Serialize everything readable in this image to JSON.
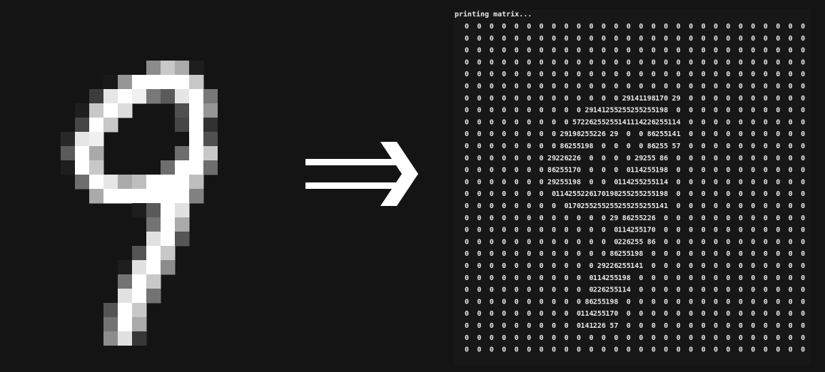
{
  "terminal": {
    "title": "printing matrix..."
  },
  "matrix": [
    [
      0,
      0,
      0,
      0,
      0,
      0,
      0,
      0,
      0,
      0,
      0,
      0,
      0,
      0,
      0,
      0,
      0,
      0,
      0,
      0,
      0,
      0,
      0,
      0,
      0,
      0,
      0,
      0
    ],
    [
      0,
      0,
      0,
      0,
      0,
      0,
      0,
      0,
      0,
      0,
      0,
      0,
      0,
      0,
      0,
      0,
      0,
      0,
      0,
      0,
      0,
      0,
      0,
      0,
      0,
      0,
      0,
      0
    ],
    [
      0,
      0,
      0,
      0,
      0,
      0,
      0,
      0,
      0,
      0,
      0,
      0,
      0,
      0,
      0,
      0,
      0,
      0,
      0,
      0,
      0,
      0,
      0,
      0,
      0,
      0,
      0,
      0
    ],
    [
      0,
      0,
      0,
      0,
      0,
      0,
      0,
      0,
      0,
      0,
      0,
      0,
      0,
      0,
      0,
      0,
      0,
      0,
      0,
      0,
      0,
      0,
      0,
      0,
      0,
      0,
      0,
      0
    ],
    [
      0,
      0,
      0,
      0,
      0,
      0,
      0,
      0,
      0,
      0,
      0,
      0,
      0,
      0,
      0,
      0,
      0,
      0,
      0,
      0,
      0,
      0,
      0,
      0,
      0,
      0,
      0,
      0
    ],
    [
      0,
      0,
      0,
      0,
      0,
      0,
      0,
      0,
      0,
      0,
      0,
      0,
      0,
      0,
      0,
      0,
      0,
      0,
      0,
      0,
      0,
      0,
      0,
      0,
      0,
      0,
      0,
      0
    ],
    [
      0,
      0,
      0,
      0,
      0,
      0,
      0,
      0,
      0,
      0,
      0,
      0,
      0,
      29,
      141,
      198,
      170,
      29,
      0,
      0,
      0,
      0,
      0,
      0,
      0,
      0,
      0,
      0
    ],
    [
      0,
      0,
      0,
      0,
      0,
      0,
      0,
      0,
      0,
      0,
      29,
      141,
      255,
      255,
      255,
      255,
      198,
      0,
      0,
      0,
      0,
      0,
      0,
      0,
      0,
      0,
      0,
      0
    ],
    [
      0,
      0,
      0,
      0,
      0,
      0,
      0,
      0,
      0,
      57,
      226,
      255,
      255,
      141,
      114,
      226,
      255,
      114,
      0,
      0,
      0,
      0,
      0,
      0,
      0,
      0,
      0,
      0
    ],
    [
      0,
      0,
      0,
      0,
      0,
      0,
      0,
      0,
      29,
      198,
      255,
      226,
      29,
      0,
      0,
      86,
      255,
      141,
      0,
      0,
      0,
      0,
      0,
      0,
      0,
      0,
      0,
      0
    ],
    [
      0,
      0,
      0,
      0,
      0,
      0,
      0,
      0,
      86,
      255,
      198,
      0,
      0,
      0,
      0,
      86,
      255,
      57,
      0,
      0,
      0,
      0,
      0,
      0,
      0,
      0,
      0,
      0
    ],
    [
      0,
      0,
      0,
      0,
      0,
      0,
      0,
      29,
      226,
      226,
      0,
      0,
      0,
      0,
      29,
      255,
      86,
      0,
      0,
      0,
      0,
      0,
      0,
      0,
      0,
      0,
      0,
      0
    ],
    [
      0,
      0,
      0,
      0,
      0,
      0,
      0,
      86,
      255,
      170,
      0,
      0,
      0,
      0,
      114,
      255,
      198,
      0,
      0,
      0,
      0,
      0,
      0,
      0,
      0,
      0,
      0,
      0
    ],
    [
      0,
      0,
      0,
      0,
      0,
      0,
      0,
      29,
      255,
      198,
      0,
      0,
      0,
      114,
      255,
      255,
      114,
      0,
      0,
      0,
      0,
      0,
      0,
      0,
      0,
      0,
      0,
      0
    ],
    [
      0,
      0,
      0,
      0,
      0,
      0,
      0,
      0,
      114,
      255,
      226,
      170,
      198,
      255,
      255,
      255,
      198,
      0,
      0,
      0,
      0,
      0,
      0,
      0,
      0,
      0,
      0,
      0
    ],
    [
      0,
      0,
      0,
      0,
      0,
      0,
      0,
      0,
      0,
      170,
      255,
      255,
      255,
      255,
      255,
      255,
      141,
      0,
      0,
      0,
      0,
      0,
      0,
      0,
      0,
      0,
      0,
      0
    ],
    [
      0,
      0,
      0,
      0,
      0,
      0,
      0,
      0,
      0,
      0,
      0,
      0,
      29,
      86,
      255,
      226,
      0,
      0,
      0,
      0,
      0,
      0,
      0,
      0,
      0,
      0,
      0,
      0
    ],
    [
      0,
      0,
      0,
      0,
      0,
      0,
      0,
      0,
      0,
      0,
      0,
      0,
      0,
      114,
      255,
      170,
      0,
      0,
      0,
      0,
      0,
      0,
      0,
      0,
      0,
      0,
      0,
      0
    ],
    [
      0,
      0,
      0,
      0,
      0,
      0,
      0,
      0,
      0,
      0,
      0,
      0,
      0,
      226,
      255,
      86,
      0,
      0,
      0,
      0,
      0,
      0,
      0,
      0,
      0,
      0,
      0,
      0
    ],
    [
      0,
      0,
      0,
      0,
      0,
      0,
      0,
      0,
      0,
      0,
      0,
      0,
      86,
      255,
      198,
      0,
      0,
      0,
      0,
      0,
      0,
      0,
      0,
      0,
      0,
      0,
      0,
      0
    ],
    [
      0,
      0,
      0,
      0,
      0,
      0,
      0,
      0,
      0,
      0,
      0,
      29,
      226,
      255,
      141,
      0,
      0,
      0,
      0,
      0,
      0,
      0,
      0,
      0,
      0,
      0,
      0,
      0
    ],
    [
      0,
      0,
      0,
      0,
      0,
      0,
      0,
      0,
      0,
      0,
      0,
      114,
      255,
      198,
      0,
      0,
      0,
      0,
      0,
      0,
      0,
      0,
      0,
      0,
      0,
      0,
      0,
      0
    ],
    [
      0,
      0,
      0,
      0,
      0,
      0,
      0,
      0,
      0,
      0,
      0,
      226,
      255,
      114,
      0,
      0,
      0,
      0,
      0,
      0,
      0,
      0,
      0,
      0,
      0,
      0,
      0,
      0
    ],
    [
      0,
      0,
      0,
      0,
      0,
      0,
      0,
      0,
      0,
      0,
      86,
      255,
      198,
      0,
      0,
      0,
      0,
      0,
      0,
      0,
      0,
      0,
      0,
      0,
      0,
      0,
      0,
      0
    ],
    [
      0,
      0,
      0,
      0,
      0,
      0,
      0,
      0,
      0,
      0,
      114,
      255,
      170,
      0,
      0,
      0,
      0,
      0,
      0,
      0,
      0,
      0,
      0,
      0,
      0,
      0,
      0,
      0
    ],
    [
      0,
      0,
      0,
      0,
      0,
      0,
      0,
      0,
      0,
      0,
      141,
      226,
      57,
      0,
      0,
      0,
      0,
      0,
      0,
      0,
      0,
      0,
      0,
      0,
      0,
      0,
      0,
      0
    ],
    [
      0,
      0,
      0,
      0,
      0,
      0,
      0,
      0,
      0,
      0,
      0,
      0,
      0,
      0,
      0,
      0,
      0,
      0,
      0,
      0,
      0,
      0,
      0,
      0,
      0,
      0,
      0,
      0
    ],
    [
      0,
      0,
      0,
      0,
      0,
      0,
      0,
      0,
      0,
      0,
      0,
      0,
      0,
      0,
      0,
      0,
      0,
      0,
      0,
      0,
      0,
      0,
      0,
      0,
      0,
      0,
      0,
      0
    ]
  ],
  "digit_pixels": {
    "width": 11,
    "height": 20,
    "shades": [
      [
        0,
        0,
        0,
        0,
        0,
        20,
        140,
        200,
        170,
        30,
        0
      ],
      [
        0,
        0,
        0,
        25,
        150,
        255,
        255,
        255,
        255,
        200,
        0
      ],
      [
        0,
        0,
        60,
        230,
        255,
        240,
        120,
        90,
        230,
        255,
        120
      ],
      [
        0,
        30,
        200,
        255,
        220,
        0,
        0,
        0,
        80,
        255,
        150
      ],
      [
        0,
        70,
        255,
        200,
        0,
        0,
        0,
        0,
        70,
        255,
        50
      ],
      [
        40,
        230,
        240,
        0,
        0,
        0,
        0,
        0,
        20,
        255,
        80
      ],
      [
        90,
        255,
        170,
        0,
        0,
        0,
        0,
        0,
        110,
        255,
        200
      ],
      [
        30,
        255,
        200,
        0,
        0,
        0,
        0,
        110,
        255,
        255,
        110
      ],
      [
        0,
        110,
        255,
        230,
        170,
        190,
        255,
        255,
        255,
        190,
        0
      ],
      [
        0,
        0,
        170,
        255,
        255,
        255,
        255,
        255,
        255,
        130,
        0
      ],
      [
        0,
        0,
        0,
        0,
        0,
        30,
        90,
        255,
        225,
        0,
        0
      ],
      [
        0,
        0,
        0,
        0,
        0,
        0,
        115,
        255,
        170,
        0,
        0
      ],
      [
        0,
        0,
        0,
        0,
        0,
        0,
        225,
        255,
        85,
        0,
        0
      ],
      [
        0,
        0,
        0,
        0,
        0,
        85,
        255,
        200,
        0,
        0,
        0
      ],
      [
        0,
        0,
        0,
        0,
        30,
        225,
        255,
        140,
        0,
        0,
        0
      ],
      [
        0,
        0,
        0,
        0,
        115,
        255,
        200,
        0,
        0,
        0,
        0
      ],
      [
        0,
        0,
        0,
        0,
        225,
        255,
        115,
        0,
        0,
        0,
        0
      ],
      [
        0,
        0,
        0,
        85,
        255,
        200,
        0,
        0,
        0,
        0,
        0
      ],
      [
        0,
        0,
        0,
        115,
        255,
        170,
        0,
        0,
        0,
        0,
        0
      ],
      [
        0,
        0,
        0,
        140,
        225,
        55,
        0,
        0,
        0,
        0,
        0
      ]
    ]
  },
  "colors": {
    "background": "#141414",
    "terminal_bg": "#171717",
    "text": "#e8e8e8",
    "arrow": "#ffffff"
  },
  "icons": {
    "arrow": "double-arrow-right-icon"
  }
}
